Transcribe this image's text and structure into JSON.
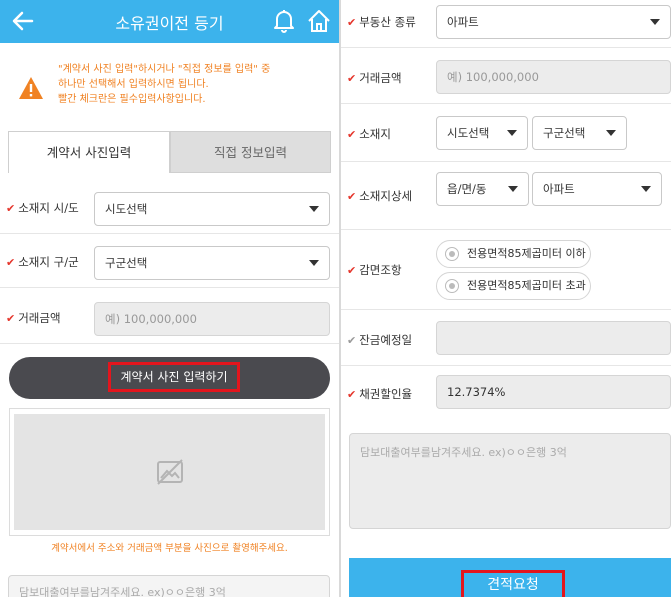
{
  "left": {
    "header": {
      "title": "소유권이전 등기"
    },
    "notice": {
      "line1": "\"계약서 사진 입력\"하시거나 \"직접 정보를 입력\" 중",
      "line2": "하나만 선택해서 입력하시면 됩니다.",
      "line3": "빨간 체크란은 필수입력사항입니다."
    },
    "tabs": {
      "photo": "계약서 사진입력",
      "direct": "직접 정보입력"
    },
    "fields": {
      "sido_label": "소재지 시/도",
      "sido_value": "시도선택",
      "gugun_label": "소재지 구/군",
      "gugun_value": "구군선택",
      "price_label": "거래금액",
      "price_placeholder": "예) 100,000,000"
    },
    "photo_button": "계약서 사진 입력하기",
    "caption": "계약서에서 주소와 거래금액 부분을 사진으로 촬영해주세요.",
    "memo_placeholder": "담보대출여부를남겨주세요. ex)ㅇㅇ은행 3억"
  },
  "right": {
    "property_type": {
      "label": "부동산 종류",
      "value": "아파트"
    },
    "price": {
      "label": "거래금액",
      "placeholder": "예) 100,000,000"
    },
    "location": {
      "label": "소재지",
      "sido": "시도선택",
      "gugun": "구군선택"
    },
    "location_detail": {
      "label": "소재지상세",
      "dong": "읍/면/동",
      "type": "아파트"
    },
    "reduction": {
      "label": "감면조항",
      "option1": "전용면적85제곱미터 이하",
      "option2": "전용면적85제곱미터 초과"
    },
    "balance_date": {
      "label": "잔금예정일"
    },
    "bond_discount": {
      "label": "채권할인율",
      "value": "12.7374%"
    },
    "memo_placeholder": "담보대출여부를남겨주세요. ex)ㅇㅇ은행 3억",
    "submit": "견적요청"
  },
  "colors": {
    "accent": "#3cb3ec",
    "required": "#e5352b",
    "notice": "#f08223",
    "highlight": "#e3151d"
  },
  "icons": [
    "back-arrow-icon",
    "bell-icon",
    "home-icon",
    "warning-icon",
    "no-image-icon",
    "check-icon",
    "caret-down-icon",
    "radio-icon"
  ]
}
